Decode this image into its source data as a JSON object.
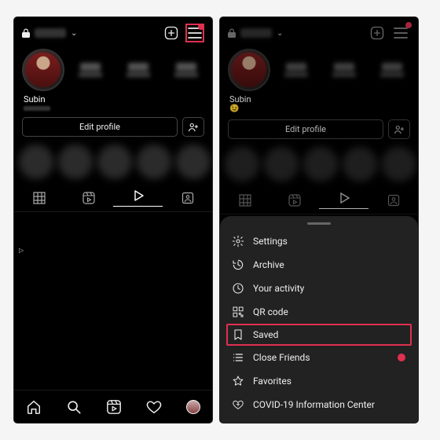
{
  "profile": {
    "display_name": "Subin",
    "edit_label": "Edit profile"
  },
  "menu": {
    "settings": "Settings",
    "archive": "Archive",
    "activity": "Your activity",
    "qr": "QR code",
    "saved": "Saved",
    "close_friends": "Close Friends",
    "favorites": "Favorites",
    "covid": "COVID-19 Information Center"
  }
}
